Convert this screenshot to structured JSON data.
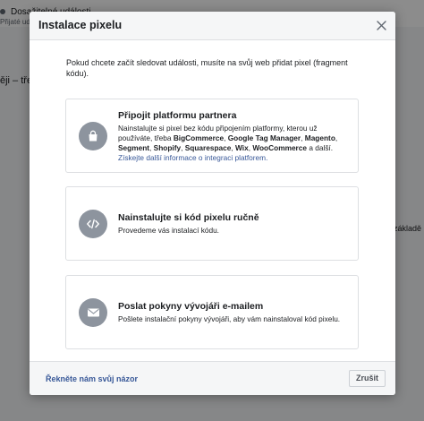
{
  "background": {
    "line1": "Dosažitelné události",
    "line2": "Přijaté události",
    "left_text": "ěji – třeb",
    "right_text": "základě"
  },
  "modal": {
    "title": "Instalace pixelu",
    "intro": "Pokud chcete začít sledovat události, musíte na svůj web přidat pixel (fragment kódu).",
    "options": [
      {
        "icon": "shopping-bag-icon",
        "title": "Připojit platformu partnera",
        "desc_prefix": "Nainstalujte si pixel bez kódu připojením platformy, kterou už používáte, třeba ",
        "platforms": [
          "BigCommerce",
          "Google Tag Manager",
          "Magento",
          "Segment",
          "Shopify",
          "Squarespace",
          "Wix",
          "WooCommerce"
        ],
        "desc_suffix": " a další.",
        "link": "Získejte další informace o integraci platforem."
      },
      {
        "icon": "code-icon",
        "title": "Nainstalujte si kód pixelu ručně",
        "desc": "Provedeme vás instalací kódu."
      },
      {
        "icon": "envelope-icon",
        "title": "Poslat pokyny vývojáři e-mailem",
        "desc": "Pošlete instalační pokyny vývojáři, aby vám nainstaloval kód pixelu."
      }
    ],
    "footer": {
      "feedback_link": "Řekněte nám svůj názor",
      "cancel_label": "Zrušit"
    }
  },
  "colors": {
    "link": "#385898",
    "icon_bg": "#8d949e",
    "border": "#dddfe2"
  }
}
